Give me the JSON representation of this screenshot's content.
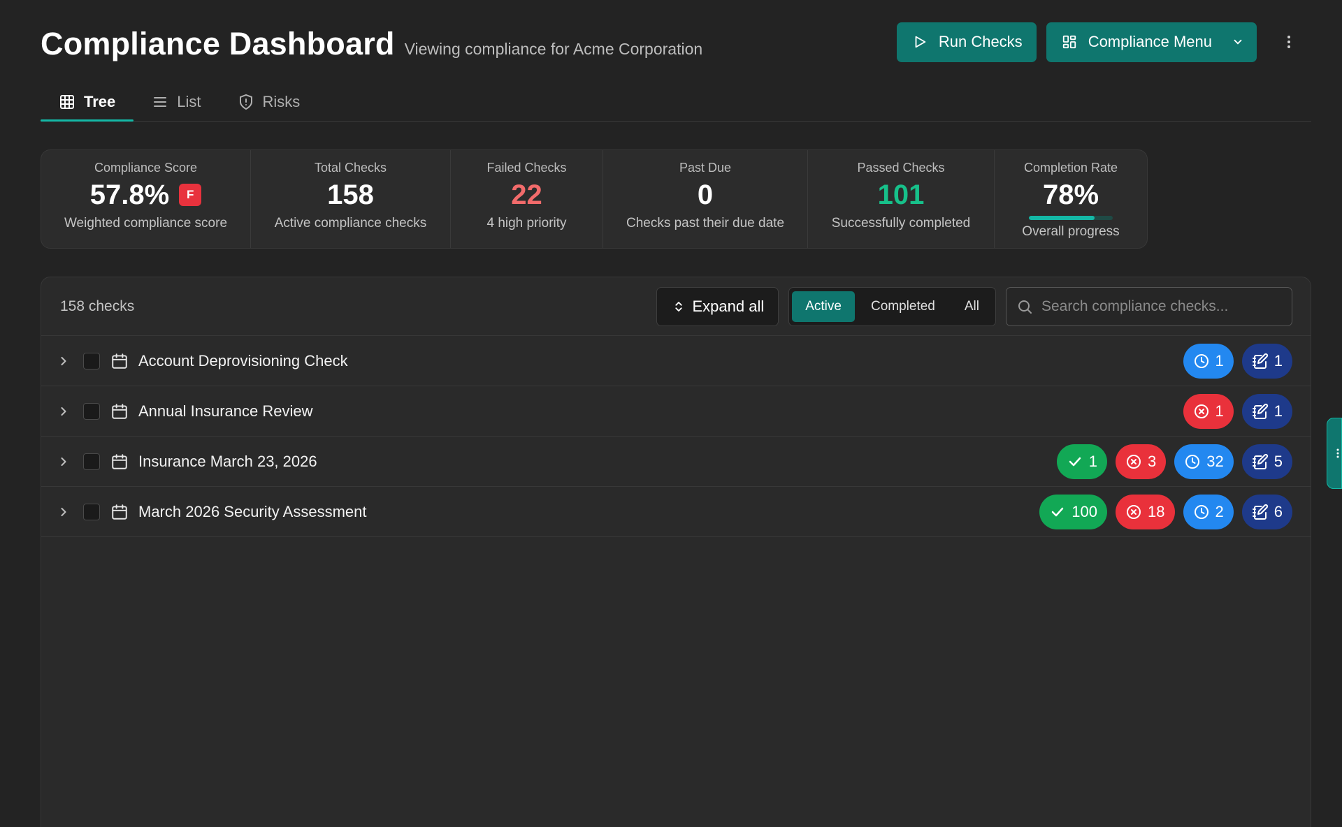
{
  "header": {
    "title": "Compliance Dashboard",
    "subtitle": "Viewing compliance for Acme Corporation",
    "run_checks_label": "Run Checks",
    "compliance_menu_label": "Compliance Menu"
  },
  "tabs": [
    {
      "label": "Tree",
      "active": true
    },
    {
      "label": "List",
      "active": false
    },
    {
      "label": "Risks",
      "active": false
    }
  ],
  "stats": {
    "compliance_score": {
      "label": "Compliance Score",
      "value": "57.8%",
      "grade": "F",
      "desc": "Weighted compliance score"
    },
    "total_checks": {
      "label": "Total Checks",
      "value": "158",
      "desc": "Active compliance checks"
    },
    "failed_checks": {
      "label": "Failed Checks",
      "value": "22",
      "desc": "4 high priority"
    },
    "past_due": {
      "label": "Past Due",
      "value": "0",
      "desc": "Checks past their due date"
    },
    "passed_checks": {
      "label": "Passed Checks",
      "value": "101",
      "desc": "Successfully completed"
    },
    "completion_rate": {
      "label": "Completion Rate",
      "value": "78%",
      "progress": 0.78,
      "desc": "Overall progress"
    }
  },
  "toolbar": {
    "count": "158 checks",
    "expand_label": "Expand all",
    "filters": [
      "Active",
      "Completed",
      "All"
    ],
    "active_filter": "Active",
    "search_placeholder": "Search compliance checks..."
  },
  "rows": [
    {
      "name": "Account Deprovisioning Check",
      "counts": {
        "passed": null,
        "failed": null,
        "pending": "1",
        "notes": "1"
      }
    },
    {
      "name": "Annual Insurance Review",
      "counts": {
        "passed": null,
        "failed": "1",
        "pending": null,
        "notes": "1"
      }
    },
    {
      "name": "Insurance March 23, 2026",
      "counts": {
        "passed": "1",
        "failed": "3",
        "pending": "32",
        "notes": "5"
      }
    },
    {
      "name": "March 2026 Security Assessment",
      "counts": {
        "passed": "100",
        "failed": "18",
        "pending": "2",
        "notes": "6"
      }
    }
  ],
  "colors": {
    "accent": "#0f766e",
    "accent_light": "#14b8a6",
    "passed": "#12a855",
    "failed": "#e9313b",
    "pending": "#2388f0",
    "notes": "#1e3a8a",
    "grade_f": "#e8323d"
  },
  "icons": {
    "run_checks": "play-icon",
    "compliance_menu": "grid-icon",
    "tree_tab": "table-icon",
    "list_tab": "list-icon",
    "risks_tab": "shield-icon",
    "expand": "chevrons-up-down-icon",
    "search": "search-icon",
    "row": "calendar-icon",
    "passed": "check-icon",
    "failed": "x-circle-icon",
    "pending": "clock-icon",
    "notes": "notebook-pen-icon"
  }
}
